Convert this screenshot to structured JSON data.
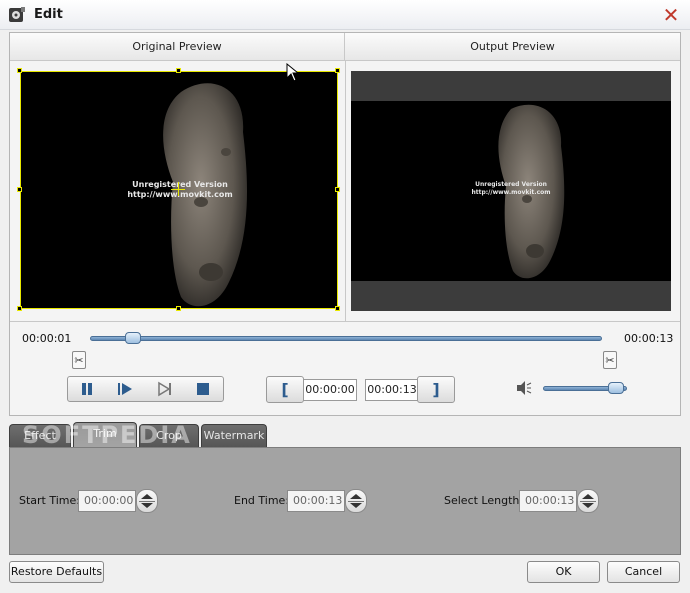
{
  "window": {
    "title": "Edit"
  },
  "preview": {
    "original_label": "Original Preview",
    "output_label": "Output Preview",
    "watermark_line1": "Unregistered Version",
    "watermark_line2": "http://www.movkit.com"
  },
  "timeline": {
    "start_time": "00:00:01",
    "end_time": "00:00:13",
    "position_fraction": 0.07
  },
  "controls": {
    "buttons": [
      "pause-icon",
      "play-next-icon",
      "skip-icon",
      "stop-icon"
    ],
    "trim_start_value": "00:00:00",
    "trim_end_value": "00:00:13",
    "volume_fraction": 0.95
  },
  "tabs": [
    {
      "label": "Effect",
      "active": false
    },
    {
      "label": "Trim",
      "active": true
    },
    {
      "label": "Crop",
      "active": false
    },
    {
      "label": "Watermark",
      "active": false
    }
  ],
  "overlay_logo": "SOFTPEDIA",
  "trim": {
    "start_label": "Start Time:",
    "start_value": "00:00:00",
    "end_label": "End Time:",
    "end_value": "00:00:13",
    "length_label": "Select Length:",
    "length_value": "00:00:13"
  },
  "footer": {
    "restore_label": "Restore Defaults",
    "ok_label": "OK",
    "cancel_label": "Cancel"
  },
  "colors": {
    "accent": "#2d5c8e",
    "crop_frame": "#e8e800",
    "close": "#c0392b"
  }
}
